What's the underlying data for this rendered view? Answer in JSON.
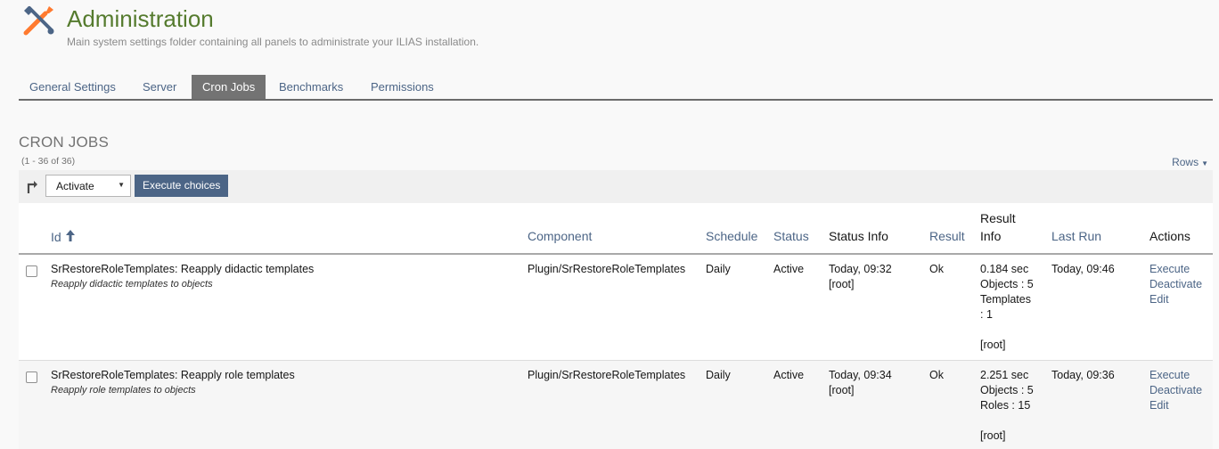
{
  "header": {
    "title": "Administration",
    "description": "Main system settings folder containing all panels to administrate your ILIAS installation.",
    "icon": "tools-icon",
    "title_color": "#557b2e"
  },
  "tabs": [
    {
      "label": "General Settings",
      "active": false
    },
    {
      "label": "Server",
      "active": false
    },
    {
      "label": "Cron Jobs",
      "active": true
    },
    {
      "label": "Benchmarks",
      "active": false
    },
    {
      "label": "Permissions",
      "active": false
    }
  ],
  "table": {
    "title": "CRON JOBS",
    "count": "(1 - 36 of 36)",
    "rows_label": "Rows",
    "action_select": "Activate",
    "execute_button": "Execute choices",
    "columns": {
      "id": "Id",
      "component": "Component",
      "schedule": "Schedule",
      "status": "Status",
      "status_info": "Status Info",
      "result": "Result",
      "result_info_1": "Result",
      "result_info_2": "Info",
      "last_run": "Last Run",
      "actions": "Actions"
    },
    "rows": [
      {
        "title": "SrRestoreRoleTemplates: Reapply didactic templates",
        "subtitle": "Reapply didactic templates to objects",
        "component": "Plugin/SrRestoreRoleTemplates",
        "schedule": "Daily",
        "status": "Active",
        "status_info_1": "Today, 09:32",
        "status_info_2": "[root]",
        "result": "Ok",
        "result_info": [
          "0.184 sec",
          "Objects : 5",
          "Templates",
          ": 1",
          "",
          "[root]"
        ],
        "last_run": "Today, 09:46",
        "actions": [
          "Execute",
          "Deactivate",
          "Edit"
        ]
      },
      {
        "title": "SrRestoreRoleTemplates: Reapply role templates",
        "subtitle": "Reapply role templates to objects",
        "component": "Plugin/SrRestoreRoleTemplates",
        "schedule": "Daily",
        "status": "Active",
        "status_info_1": "Today, 09:34",
        "status_info_2": "[root]",
        "result": "Ok",
        "result_info": [
          "2.251 sec",
          "Objects : 5",
          "Roles : 15",
          "",
          "[root]"
        ],
        "last_run": "Today, 09:36",
        "actions": [
          "Execute",
          "Deactivate",
          "Edit"
        ]
      }
    ]
  }
}
